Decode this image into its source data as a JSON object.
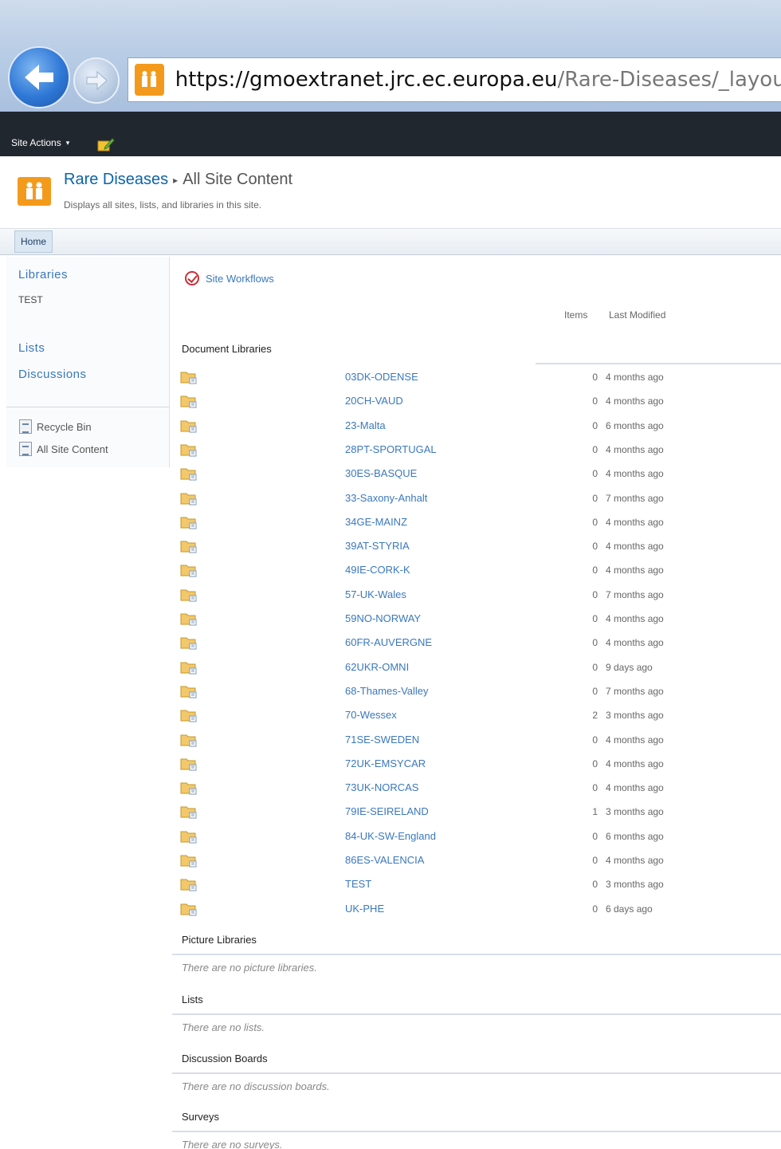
{
  "browser": {
    "url_host": "https://gmoextranet.jrc.ec.europa.eu",
    "url_path": "/Rare-Diseases/_layouts/vie"
  },
  "ribbon": {
    "site_actions_label": "Site Actions",
    "site_actions_caret": "▾"
  },
  "header": {
    "site_name": "Rare Diseases",
    "separator": "▸",
    "page_title": "All Site Content",
    "description": "Displays all sites, lists, and libraries in this site."
  },
  "topnav": {
    "home_label": "Home"
  },
  "quicklaunch": {
    "libraries_heading": "Libraries",
    "libraries_item": "TEST",
    "lists_heading": "Lists",
    "discussions_heading": "Discussions",
    "recycle_bin": "Recycle Bin",
    "all_site_content": "All Site Content"
  },
  "main": {
    "site_workflows_label": "Site Workflows",
    "col_items": "Items",
    "col_last_modified": "Last Modified",
    "document_libraries_title": "Document Libraries",
    "document_libraries": [
      {
        "name": "03DK-ODENSE",
        "items": "0",
        "modified": "4 months ago"
      },
      {
        "name": "20CH-VAUD",
        "items": "0",
        "modified": "4 months ago"
      },
      {
        "name": "23-Malta",
        "items": "0",
        "modified": "6 months ago"
      },
      {
        "name": "28PT-SPORTUGAL",
        "items": "0",
        "modified": "4 months ago"
      },
      {
        "name": "30ES-BASQUE",
        "items": "0",
        "modified": "4 months ago"
      },
      {
        "name": "33-Saxony-Anhalt",
        "items": "0",
        "modified": "7 months ago"
      },
      {
        "name": "34GE-MAINZ",
        "items": "0",
        "modified": "4 months ago"
      },
      {
        "name": "39AT-STYRIA",
        "items": "0",
        "modified": "4 months ago"
      },
      {
        "name": "49IE-CORK-K",
        "items": "0",
        "modified": "4 months ago"
      },
      {
        "name": "57-UK-Wales",
        "items": "0",
        "modified": "7 months ago"
      },
      {
        "name": "59NO-NORWAY",
        "items": "0",
        "modified": "4 months ago"
      },
      {
        "name": "60FR-AUVERGNE",
        "items": "0",
        "modified": "4 months ago"
      },
      {
        "name": "62UKR-OMNI",
        "items": "0",
        "modified": "9 days ago"
      },
      {
        "name": "68-Thames-Valley",
        "items": "0",
        "modified": "7 months ago"
      },
      {
        "name": "70-Wessex",
        "items": "2",
        "modified": "3 months ago"
      },
      {
        "name": "71SE-SWEDEN",
        "items": "0",
        "modified": "4 months ago"
      },
      {
        "name": "72UK-EMSYCAR",
        "items": "0",
        "modified": "4 months ago"
      },
      {
        "name": "73UK-NORCAS",
        "items": "0",
        "modified": "4 months ago"
      },
      {
        "name": "79IE-SEIRELAND",
        "items": "1",
        "modified": "3 months ago"
      },
      {
        "name": "84-UK-SW-England",
        "items": "0",
        "modified": "6 months ago"
      },
      {
        "name": "86ES-VALENCIA",
        "items": "0",
        "modified": "4 months ago"
      },
      {
        "name": "TEST",
        "items": "0",
        "modified": "3 months ago"
      },
      {
        "name": "UK-PHE",
        "items": "0",
        "modified": "6 days ago"
      }
    ],
    "sections": [
      {
        "title": "Picture Libraries",
        "empty": "There are no picture libraries."
      },
      {
        "title": "Lists",
        "empty": "There are no lists."
      },
      {
        "title": "Discussion Boards",
        "empty": "There are no discussion boards."
      },
      {
        "title": "Surveys",
        "empty": "There are no surveys."
      }
    ]
  }
}
